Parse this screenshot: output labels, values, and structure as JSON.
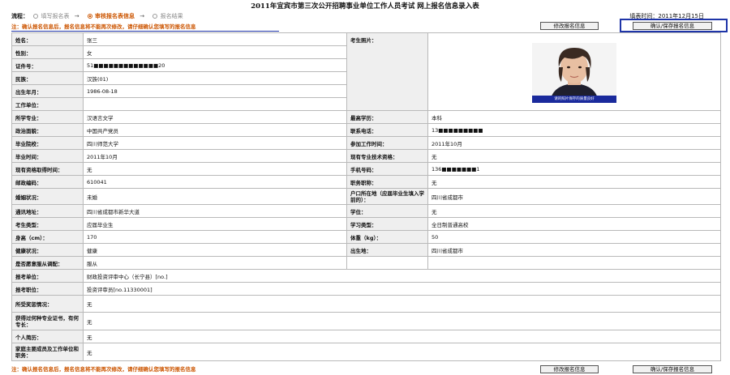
{
  "header": {
    "title": "2011年宜宾市第三次公开招聘事业单位工作人员考试 网上报名信息录入表",
    "flow_label": "流程：",
    "steps": [
      "填写报名表",
      "审核报名表信息",
      "报名结果"
    ],
    "arrow": "→",
    "fill_time_label": "填表时间：",
    "fill_time": "2011年12月15日"
  },
  "notice": "注：确认报名信息后，报名信息将不能再次修改，请仔细确认您填写的报名信息",
  "buttons": {
    "edit": "修改报名信息",
    "confirm": "确认/保存报名信息"
  },
  "photo": {
    "label": "考生照片：",
    "caption": "请的照片保存的质量良好"
  },
  "fields": {
    "name": {
      "label": "姓名：",
      "value": "张三"
    },
    "gender": {
      "label": "性别：",
      "value": "女"
    },
    "id_no": {
      "label": "证件号：",
      "value": "51■■■■■■■■■■■■■20"
    },
    "ethnicity": {
      "label": "民族：",
      "value": "汉族(01)"
    },
    "birth": {
      "label": "出生年月：",
      "value": "1986-08-18"
    },
    "employer": {
      "label": "工作单位：",
      "value": ""
    },
    "major": {
      "label": "所学专业：",
      "value": "汉语言文学"
    },
    "education": {
      "label": "最高学历：",
      "value": "本科"
    },
    "political": {
      "label": "政治面貌：",
      "value": "中国共产党员"
    },
    "phone": {
      "label": "联系电话：",
      "value": "13■■■■■■■■■"
    },
    "school": {
      "label": "毕业院校：",
      "value": "四川师范大学"
    },
    "work_start": {
      "label": "参加工作时间：",
      "value": "2011年10月"
    },
    "grad_time": {
      "label": "毕业时间：",
      "value": "2011年10月"
    },
    "tech_quali": {
      "label": "现有专业技术资格：",
      "value": "无"
    },
    "cert_time": {
      "label": "现有资格取得时间：",
      "value": "无"
    },
    "mobile": {
      "label": "手机号码：",
      "value": "136■■■■■■■1"
    },
    "postcode": {
      "label": "邮政编码：",
      "value": "610041"
    },
    "title_rank": {
      "label": "职务职称：",
      "value": "无"
    },
    "marital": {
      "label": "婚姻状况：",
      "value": "未婚"
    },
    "hukou": {
      "label": "户口所在地（应届毕业生填入学前的）：",
      "value": "四川省成都市"
    },
    "address": {
      "label": "通讯地址：",
      "value": "四川省成都市新华大道"
    },
    "degree": {
      "label": "学位：",
      "value": "无"
    },
    "candidate_type": {
      "label": "考生类型：",
      "value": "应届毕业生"
    },
    "study_type": {
      "label": "学习类型：",
      "value": "全日制普通高校"
    },
    "height": {
      "label": "身高（cm）：",
      "value": "170"
    },
    "weight": {
      "label": "体重（kg）：",
      "value": "50"
    },
    "health": {
      "label": "健康状况：",
      "value": "健康"
    },
    "birthplace": {
      "label": "出生地：",
      "value": "四川省成都市"
    },
    "obey": {
      "label": "是否愿意服从调配：",
      "value": "服从"
    },
    "unit": {
      "label": "报考单位：",
      "value": "财政投资评审中心（长宁县）[no.]"
    },
    "position": {
      "label": "报考职位：",
      "value": "投资评审员[no.11330001]"
    },
    "awards": {
      "label": "所受奖惩情况：",
      "value": "无"
    },
    "skills": {
      "label": "获得过何种专业证书，有何专长：",
      "value": "无"
    },
    "resume": {
      "label": "个人简历：",
      "value": "无"
    },
    "family": {
      "label": "家庭主要成员及工作单位和职务：",
      "value": "无"
    }
  }
}
